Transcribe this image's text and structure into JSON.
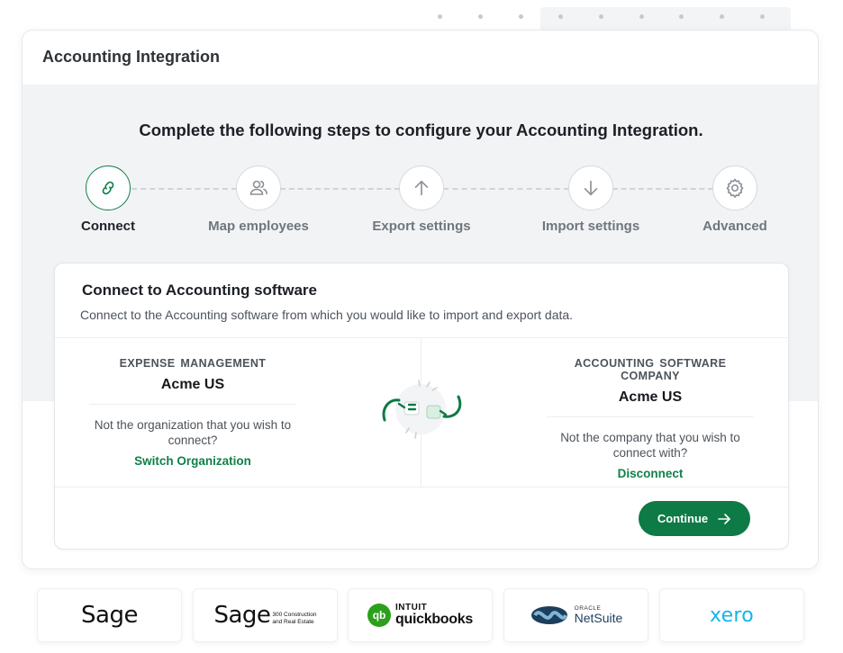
{
  "window": {
    "title": "Accounting Integration"
  },
  "heading": "Complete the following steps to configure your Accounting Integration.",
  "steps": [
    {
      "label": "Connect",
      "icon": "link-icon",
      "active": true
    },
    {
      "label": "Map employees",
      "icon": "users-icon",
      "active": false
    },
    {
      "label": "Export settings",
      "icon": "arrow-up-icon",
      "active": false
    },
    {
      "label": "Import settings",
      "icon": "arrow-down-icon",
      "active": false
    },
    {
      "label": "Advanced",
      "icon": "gear-icon",
      "active": false
    }
  ],
  "card": {
    "title": "Connect to Accounting software",
    "subtitle": "Connect to the Accounting software from which you would like to import and export data.",
    "left": {
      "heading": "EXPENSE  MANAGEMENT",
      "org_name": "Acme US",
      "question": "Not the organization that you wish to connect?",
      "link": "Switch Organization"
    },
    "right": {
      "heading": "ACCOUNTING SOFTWARE COMPANY",
      "org_name": "Acme US",
      "question": "Not the company that you wish to connect with?",
      "link": "Disconnect"
    },
    "continue_label": "Continue"
  },
  "logos": {
    "sage": "Sage",
    "sage300": {
      "word": "Sage",
      "line1": "300 Construction",
      "line2": "and Real Estate"
    },
    "quickbooks": {
      "badge": "qb",
      "intuit": "INTUIT",
      "name": "quickbooks"
    },
    "netsuite": {
      "oracle": "ORACLE",
      "name": "NetSuite"
    },
    "xero": "xero"
  },
  "colors": {
    "accent": "#0e7a45",
    "link": "#10804a",
    "band": "#f1f3f5"
  }
}
